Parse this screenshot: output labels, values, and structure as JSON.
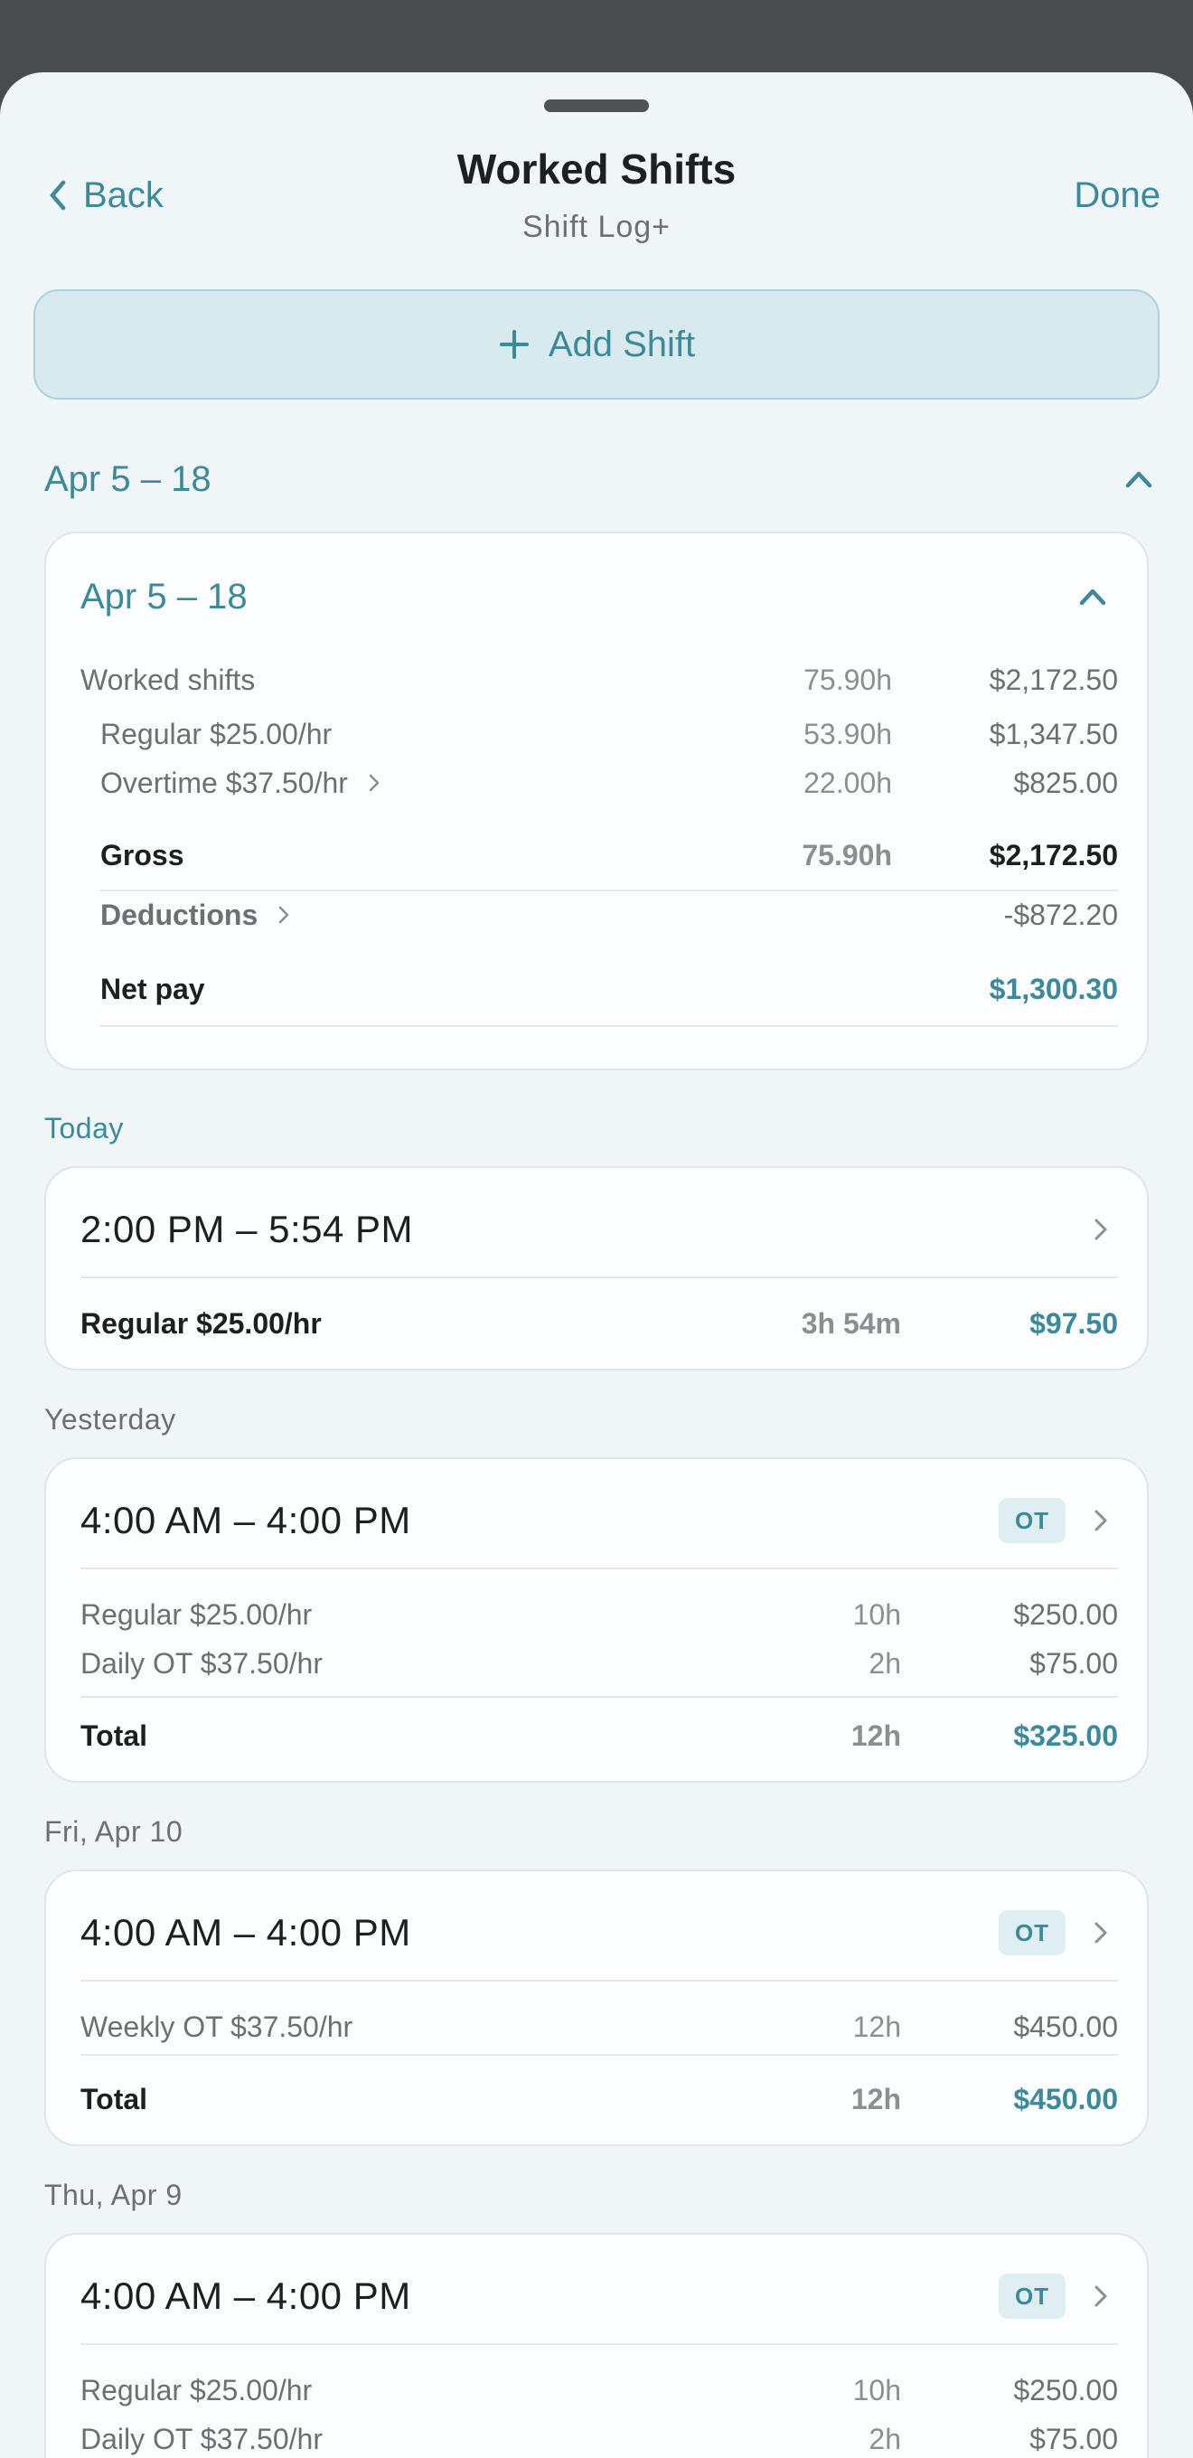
{
  "header": {
    "back_label": "Back",
    "title": "Worked Shifts",
    "subtitle": "Shift Log+",
    "done_label": "Done"
  },
  "add_shift_label": "Add Shift",
  "period": {
    "label": "Apr 5 – 18"
  },
  "summary": {
    "title": "Apr 5 – 18",
    "worked": {
      "label": "Worked shifts",
      "hours": "75.90h",
      "amount": "$2,172.50"
    },
    "regular": {
      "label": "Regular $25.00/hr",
      "hours": "53.90h",
      "amount": "$1,347.50"
    },
    "overtime": {
      "label": "Overtime $37.50/hr",
      "hours": "22.00h",
      "amount": "$825.00"
    },
    "gross": {
      "label": "Gross",
      "hours": "75.90h",
      "amount": "$2,172.50"
    },
    "deductions": {
      "label": "Deductions",
      "amount": "-$872.20"
    },
    "net": {
      "label": "Net pay",
      "amount": "$1,300.30"
    }
  },
  "days": [
    {
      "label": "Today",
      "time": "2:00 PM – 5:54 PM",
      "rows": [
        {
          "label": "Regular $25.00/hr",
          "hours": "3h 54m",
          "amount": "$97.50"
        }
      ]
    },
    {
      "label": "Yesterday",
      "time": "4:00 AM – 4:00 PM",
      "badge": "OT",
      "rows": [
        {
          "label": "Regular $25.00/hr",
          "hours": "10h",
          "amount": "$250.00"
        },
        {
          "label": "Daily OT $37.50/hr",
          "hours": "2h",
          "amount": "$75.00"
        }
      ],
      "total": {
        "label": "Total",
        "hours": "12h",
        "amount": "$325.00"
      }
    },
    {
      "label": "Fri, Apr 10",
      "time": "4:00 AM – 4:00 PM",
      "badge": "OT",
      "rows": [
        {
          "label": "Weekly OT $37.50/hr",
          "hours": "12h",
          "amount": "$450.00"
        }
      ],
      "total": {
        "label": "Total",
        "hours": "12h",
        "amount": "$450.00"
      }
    },
    {
      "label": "Thu, Apr 9",
      "time": "4:00 AM – 4:00 PM",
      "badge": "OT",
      "rows": [
        {
          "label": "Regular $25.00/hr",
          "hours": "10h",
          "amount": "$250.00"
        },
        {
          "label": "Daily OT $37.50/hr",
          "hours": "2h",
          "amount": "$75.00"
        }
      ]
    }
  ],
  "colors": {
    "accent": "#3b8a9b",
    "background": "#f0f5f8",
    "card": "#fbfdfe"
  }
}
